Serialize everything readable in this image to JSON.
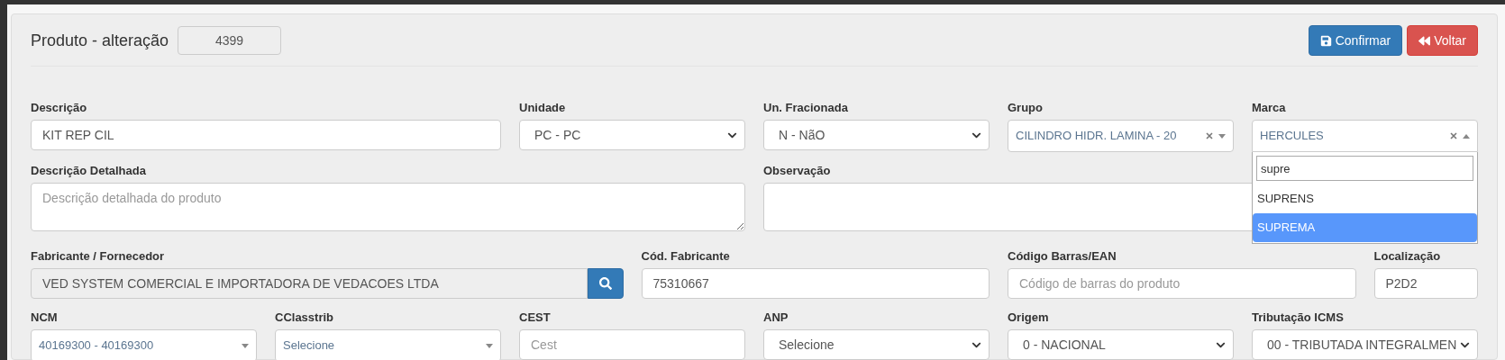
{
  "header": {
    "title": "Produto - alteração",
    "record_id": {
      "value": "4399",
      "readonly": true
    },
    "buttons": [
      {
        "label": "Confirmar",
        "kind": "primary"
      },
      {
        "label": "Voltar",
        "kind": "danger"
      }
    ]
  },
  "fields": [
    {
      "kind": "text",
      "label": "Descrição",
      "value": "KIT REP CIL",
      "readonly": false
    },
    {
      "kind": "select",
      "label": "Unidade",
      "value": "PC - PC"
    },
    {
      "kind": "select",
      "label": "Un. Fracionada",
      "value": "N - NãO"
    },
    {
      "kind": "combo",
      "label": "Grupo",
      "value": "CILINDRO HIDR. LAMINA - 20",
      "clearable": true,
      "expanded": false
    },
    {
      "kind": "combo",
      "label": "Marca",
      "value": "HERCULES",
      "clearable": true,
      "expanded": true,
      "search": "supre",
      "options": [
        {
          "label": "SUPRENS",
          "selected": false
        },
        {
          "label": "SUPREMA",
          "selected": true
        }
      ]
    },
    {
      "kind": "textarea",
      "label": "Descrição Detalhada",
      "placeholder": "Descrição detalhada do produto"
    },
    {
      "kind": "textarea",
      "label": "Observação"
    },
    {
      "kind": "lookup",
      "label": "Fabricante / Fornecedor",
      "value": "VED SYSTEM COMERCIAL E IMPORTADORA DE VEDACOES LTDA",
      "readonly": true
    },
    {
      "kind": "text",
      "label": "Cód. Fabricante",
      "value": "75310667",
      "readonly": false
    },
    {
      "kind": "text",
      "label": "Código Barras/EAN",
      "placeholder": "Código de barras do produto",
      "readonly": false
    },
    {
      "kind": "text",
      "label": "Localização",
      "value": "P2D2",
      "readonly": false
    },
    {
      "kind": "combo",
      "label": "NCM",
      "value": "40169300 - 40169300",
      "clearable": false,
      "expanded": false
    },
    {
      "kind": "combo",
      "label": "CClasstrib",
      "value": "Selecione",
      "clearable": false,
      "expanded": false
    },
    {
      "kind": "text",
      "label": "CEST",
      "placeholder": "Cest",
      "readonly": false
    },
    {
      "kind": "select",
      "label": "ANP",
      "value": "Selecione"
    },
    {
      "kind": "select",
      "label": "Origem",
      "value": "0 - NACIONAL"
    },
    {
      "kind": "select",
      "label": "Tributação ICMS",
      "value": "00 - TRIBUTADA INTEGRALMEN"
    }
  ]
}
